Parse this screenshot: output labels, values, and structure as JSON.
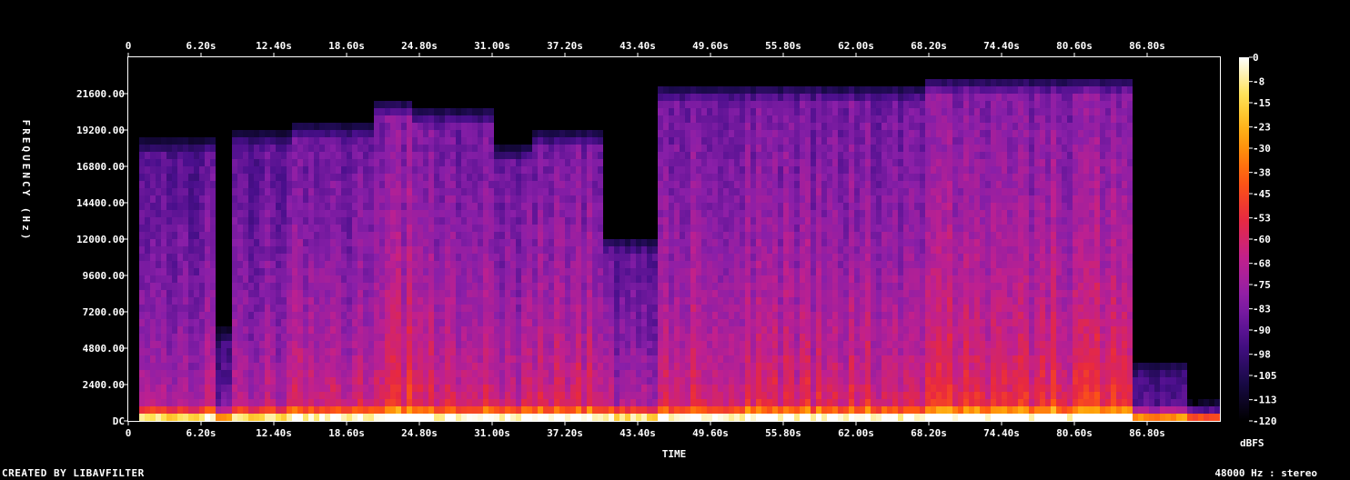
{
  "chart_data": {
    "type": "heatmap",
    "title": "",
    "xlabel": "TIME",
    "ylabel": "FREQUENCY (Hz)",
    "x_ticks": [
      "0",
      "6.20s",
      "12.40s",
      "18.60s",
      "24.80s",
      "31.00s",
      "37.20s",
      "43.40s",
      "49.60s",
      "55.80s",
      "62.00s",
      "68.20s",
      "74.40s",
      "80.60s",
      "86.80s"
    ],
    "x_tick_values": [
      0,
      6.2,
      12.4,
      18.6,
      24.8,
      31.0,
      37.2,
      43.4,
      49.6,
      55.8,
      62.0,
      68.2,
      74.4,
      80.6,
      86.8
    ],
    "xlim": [
      0,
      93.0
    ],
    "y_ticks": [
      "DC",
      "2400.00",
      "4800.00",
      "7200.00",
      "9600.00",
      "12000.00",
      "14400.00",
      "16800.00",
      "19200.00",
      "21600.00"
    ],
    "y_tick_values": [
      0,
      2400,
      4800,
      7200,
      9600,
      12000,
      14400,
      16800,
      19200,
      21600
    ],
    "ylim": [
      0,
      24000
    ],
    "colorbar_label": "dBFS",
    "colorbar_ticks": [
      "0",
      "-8",
      "-15",
      "-23",
      "-30",
      "-38",
      "-45",
      "-53",
      "-60",
      "-68",
      "-75",
      "-83",
      "-90",
      "-98",
      "-105",
      "-113",
      "-120"
    ],
    "colorbar_values": [
      0,
      -8,
      -15,
      -23,
      -30,
      -38,
      -45,
      -53,
      -60,
      -68,
      -75,
      -83,
      -90,
      -98,
      -105,
      -113,
      -120
    ],
    "clim": [
      -120,
      0
    ],
    "colormap": [
      "#000000",
      "#1a0a4a",
      "#4a0f8c",
      "#8a1fa8",
      "#c0208f",
      "#e8293f",
      "#ff5a10",
      "#ffa30a",
      "#ffe04a",
      "#ffffff"
    ],
    "segments": [
      {
        "t0": 0.0,
        "t1": 1.0,
        "level": 0.0,
        "cutoff": 0
      },
      {
        "t0": 1.0,
        "t1": 7.5,
        "level": 0.55,
        "cutoff": 18500
      },
      {
        "t0": 7.5,
        "t1": 9.0,
        "level": 0.38,
        "cutoff": 6000
      },
      {
        "t0": 9.0,
        "t1": 14.0,
        "level": 0.55,
        "cutoff": 19000
      },
      {
        "t0": 14.0,
        "t1": 21.0,
        "level": 0.62,
        "cutoff": 19500
      },
      {
        "t0": 21.0,
        "t1": 24.0,
        "level": 0.7,
        "cutoff": 21000
      },
      {
        "t0": 24.0,
        "t1": 31.0,
        "level": 0.66,
        "cutoff": 20500
      },
      {
        "t0": 31.0,
        "t1": 34.5,
        "level": 0.6,
        "cutoff": 18000
      },
      {
        "t0": 34.5,
        "t1": 40.5,
        "level": 0.68,
        "cutoff": 19000
      },
      {
        "t0": 40.5,
        "t1": 45.0,
        "level": 0.55,
        "cutoff": 12000
      },
      {
        "t0": 45.0,
        "t1": 68.0,
        "level": 0.64,
        "cutoff": 22000
      },
      {
        "t0": 68.0,
        "t1": 85.5,
        "level": 0.7,
        "cutoff": 22500
      },
      {
        "t0": 85.5,
        "t1": 90.0,
        "level": 0.4,
        "cutoff": 4000
      },
      {
        "t0": 90.0,
        "t1": 93.0,
        "level": 0.25,
        "cutoff": 1500
      }
    ]
  },
  "footer": {
    "credit": "CREATED BY LIBAVFILTER",
    "info": "48000 Hz : stereo"
  }
}
